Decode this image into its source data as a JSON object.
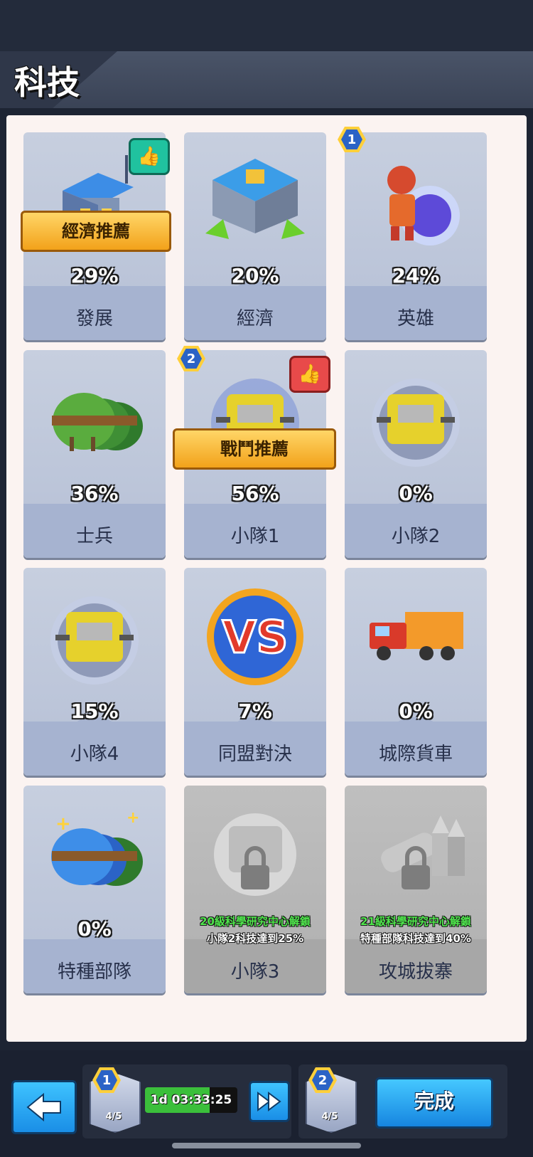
{
  "header": {
    "title": "科技"
  },
  "cards": [
    {
      "name": "發展",
      "percent": "29%",
      "ribbon": "經濟推薦"
    },
    {
      "name": "經濟",
      "percent": "20%"
    },
    {
      "name": "英雄",
      "percent": "24%",
      "badge": "1"
    },
    {
      "name": "士兵",
      "percent": "36%"
    },
    {
      "name": "小隊1",
      "percent": "56%",
      "ribbon": "戰鬥推薦",
      "badge": "2"
    },
    {
      "name": "小隊2",
      "percent": "0%"
    },
    {
      "name": "小隊4",
      "percent": "15%"
    },
    {
      "name": "同盟對決",
      "percent": "7%",
      "art_text": "VS"
    },
    {
      "name": "城際貨車",
      "percent": "0%"
    },
    {
      "name": "特種部隊",
      "percent": "0%"
    },
    {
      "name": "小隊3",
      "locked": true,
      "unlock_line1": "20級科學研究中心解鎖",
      "unlock_line2": "小隊2科技達到25%"
    },
    {
      "name": "攻城拔寨",
      "locked": true,
      "unlock_line1": "21級科學研究中心解鎖",
      "unlock_line2": "特種部隊科技達到40%"
    }
  ],
  "footer": {
    "queue1": {
      "badge": "1",
      "count": "4/5"
    },
    "timer": {
      "text": "1d 03:33:25",
      "progress": 0.7
    },
    "queue2": {
      "badge": "2",
      "count": "4/5"
    },
    "done_label": "完成"
  },
  "colors": {
    "accent_blue": "#1a8ee6",
    "ribbon_gold": "#f2a21a",
    "unlock_green": "#4fe64c"
  },
  "icons": [
    "back-arrow-icon",
    "fast-forward-icon",
    "thumbs-up-icon",
    "lock-icon"
  ]
}
